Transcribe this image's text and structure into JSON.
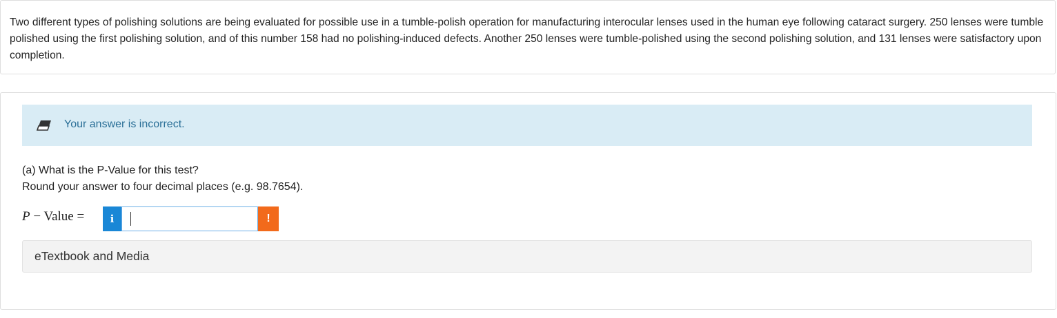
{
  "problem": {
    "text": "Two different types of polishing solutions are being evaluated for possible use in a tumble-polish operation for manufacturing interocular lenses used in the human eye following cataract surgery. 250 lenses were tumble polished using the first polishing solution, and of this number 158 had no polishing-induced defects. Another 250 lenses were tumble-polished using the second polishing solution, and 131 lenses were satisfactory upon completion."
  },
  "feedback": {
    "icon": "eraser-icon",
    "message": "Your answer is incorrect.",
    "color": "#2a6f97",
    "background": "#d9ecf5"
  },
  "question": {
    "line1": "(a) What is the P-Value for this test?",
    "line2": "Round your answer to four decimal places (e.g. 98.7654).",
    "label_p": "P",
    "label_rest": " − Value = ",
    "info_button": "i",
    "answer_value": "",
    "warning_button": "!",
    "info_color": "#1a87d6",
    "warning_color": "#f26a1b"
  },
  "resources": {
    "etextbook_label": "eTextbook and Media"
  }
}
